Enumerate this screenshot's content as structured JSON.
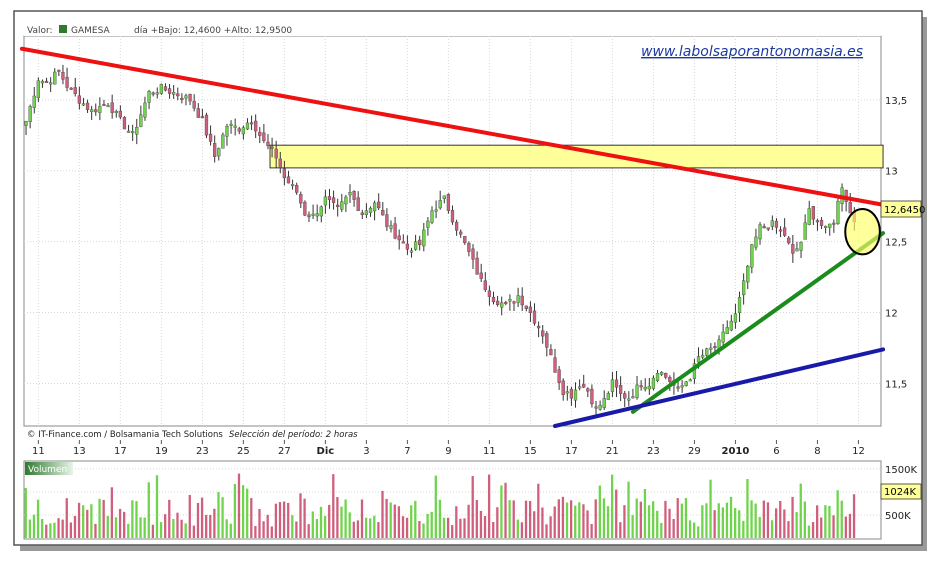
{
  "header": {
    "label_valor": "Valor:",
    "ticker": "GAMESA",
    "stats": "día +Bajo: 12,4600 +Alto: 12,9500"
  },
  "watermark": "www.labolsaporantonomasia.es",
  "footer": {
    "credit": "© IT-Finance.com / Bolsamania Tech Solutions",
    "period": "Selección del período: 2 horas"
  },
  "volume_panel": {
    "label": "Volumen",
    "last_value": "1024K",
    "ticks": [
      {
        "label": "1500K",
        "value": 1500
      },
      {
        "label": "1000K",
        "value": 1000
      },
      {
        "label": "500K",
        "value": 500
      }
    ]
  },
  "colors": {
    "up": "#6fd44c",
    "down": "#d05f7e",
    "resistance": "#ee1111",
    "support_short": "#1b8c1b",
    "support_long": "#1a1aa8",
    "zone": "#ffff99",
    "frame_border": "#6a6a6a",
    "price_tag": "#ffff99"
  },
  "chart_data": {
    "type": "candlestick",
    "ylim": [
      11.2,
      13.95
    ],
    "yticks": [
      {
        "label": "13,5",
        "value": 13.5
      },
      {
        "label": "13",
        "value": 13.0
      },
      {
        "label": "12,5",
        "value": 12.5
      },
      {
        "label": "12",
        "value": 12.0
      },
      {
        "label": "11,5",
        "value": 11.5
      }
    ],
    "last_price": {
      "label": "12,6450",
      "value": 12.645
    },
    "xticks": [
      {
        "label": "11",
        "pos": 3
      },
      {
        "label": "13",
        "pos": 13
      },
      {
        "label": "17",
        "pos": 23
      },
      {
        "label": "19",
        "pos": 33
      },
      {
        "label": "23",
        "pos": 43
      },
      {
        "label": "25",
        "pos": 53
      },
      {
        "label": "27",
        "pos": 63
      },
      {
        "label": "Dic",
        "pos": 73
      },
      {
        "label": "3",
        "pos": 83
      },
      {
        "label": "7",
        "pos": 93
      },
      {
        "label": "9",
        "pos": 103
      },
      {
        "label": "11",
        "pos": 113
      },
      {
        "label": "15",
        "pos": 123
      },
      {
        "label": "17",
        "pos": 133
      },
      {
        "label": "21",
        "pos": 143
      },
      {
        "label": "23",
        "pos": 153
      },
      {
        "label": "29",
        "pos": 163
      },
      {
        "label": "2010",
        "pos": 173
      },
      {
        "label": "6",
        "pos": 183
      },
      {
        "label": "8",
        "pos": 193
      },
      {
        "label": "12",
        "pos": 203
      }
    ],
    "n_slots": 209,
    "close_points": [
      [
        0,
        13.35
      ],
      [
        3,
        13.65
      ],
      [
        5,
        13.62
      ],
      [
        8,
        13.7
      ],
      [
        10,
        13.6
      ],
      [
        13,
        13.5
      ],
      [
        16,
        13.42
      ],
      [
        20,
        13.48
      ],
      [
        23,
        13.35
      ],
      [
        26,
        13.25
      ],
      [
        30,
        13.55
      ],
      [
        33,
        13.58
      ],
      [
        36,
        13.55
      ],
      [
        40,
        13.5
      ],
      [
        43,
        13.35
      ],
      [
        46,
        13.1
      ],
      [
        49,
        13.32
      ],
      [
        52,
        13.3
      ],
      [
        55,
        13.36
      ],
      [
        58,
        13.2
      ],
      [
        61,
        13.1
      ],
      [
        63,
        12.95
      ],
      [
        66,
        12.85
      ],
      [
        68,
        12.7
      ],
      [
        70,
        12.68
      ],
      [
        73,
        12.8
      ],
      [
        76,
        12.72
      ],
      [
        79,
        12.84
      ],
      [
        82,
        12.7
      ],
      [
        85,
        12.78
      ],
      [
        88,
        12.62
      ],
      [
        91,
        12.52
      ],
      [
        93,
        12.45
      ],
      [
        96,
        12.48
      ],
      [
        99,
        12.72
      ],
      [
        102,
        12.8
      ],
      [
        105,
        12.6
      ],
      [
        108,
        12.42
      ],
      [
        111,
        12.22
      ],
      [
        114,
        12.1
      ],
      [
        117,
        12.05
      ],
      [
        120,
        12.12
      ],
      [
        123,
        12.0
      ],
      [
        126,
        11.85
      ],
      [
        129,
        11.6
      ],
      [
        131,
        11.45
      ],
      [
        133,
        11.42
      ],
      [
        135,
        11.5
      ],
      [
        137,
        11.45
      ],
      [
        139,
        11.32
      ],
      [
        141,
        11.38
      ],
      [
        143,
        11.5
      ],
      [
        145,
        11.42
      ],
      [
        147,
        11.4
      ],
      [
        150,
        11.5
      ],
      [
        152,
        11.5
      ],
      [
        154,
        11.6
      ],
      [
        157,
        11.52
      ],
      [
        159,
        11.45
      ],
      [
        162,
        11.55
      ],
      [
        164,
        11.68
      ],
      [
        166,
        11.72
      ],
      [
        169,
        11.78
      ],
      [
        171,
        11.9
      ],
      [
        173,
        11.98
      ],
      [
        175,
        12.2
      ],
      [
        177,
        12.45
      ],
      [
        179,
        12.6
      ],
      [
        182,
        12.62
      ],
      [
        185,
        12.55
      ],
      [
        187,
        12.4
      ],
      [
        189,
        12.5
      ],
      [
        191,
        12.72
      ],
      [
        193,
        12.65
      ],
      [
        195,
        12.58
      ],
      [
        197,
        12.65
      ],
      [
        199,
        12.9
      ],
      [
        201,
        12.7
      ],
      [
        202,
        12.65
      ]
    ],
    "resistance_line": {
      "start": [
        -1,
        13.86
      ],
      "end": [
        209,
        12.76
      ]
    },
    "support_short": {
      "start": [
        148,
        11.3
      ],
      "end": [
        209,
        12.56
      ]
    },
    "support_long": {
      "start": [
        129,
        11.2
      ],
      "end": [
        209,
        11.74
      ]
    },
    "zone": {
      "x0": 60,
      "x1": 209,
      "y0": 13.02,
      "y1": 13.18
    },
    "circle_mark": {
      "x": 204,
      "y": 12.57,
      "rx": 3,
      "ry": 0.16
    }
  }
}
